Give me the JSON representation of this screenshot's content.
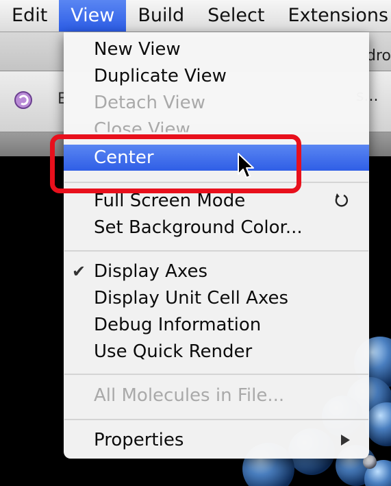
{
  "menubar": {
    "items": [
      "Edit",
      "View",
      "Build",
      "Select",
      "Extensions"
    ],
    "active": "View"
  },
  "background": {
    "tab_text": "dro",
    "toolbar_peek_letter": "E",
    "toolbar_dropdown_text": "s..."
  },
  "view_menu": {
    "items": [
      {
        "label": "New View",
        "enabled": true
      },
      {
        "label": "Duplicate View",
        "enabled": true
      },
      {
        "label": "Detach View",
        "enabled": false
      },
      {
        "label": "Close View",
        "enabled": false
      },
      {
        "label": "Center",
        "enabled": true,
        "highlighted": true
      },
      {
        "label": "Full Screen Mode",
        "enabled": true,
        "shortcut_icon": "rotate-refresh-icon"
      },
      {
        "label": "Set Background Color...",
        "enabled": true
      },
      {
        "label": "Display Axes",
        "enabled": true,
        "checked": true
      },
      {
        "label": "Display Unit Cell Axes",
        "enabled": true
      },
      {
        "label": "Debug Information",
        "enabled": true
      },
      {
        "label": "Use Quick Render",
        "enabled": true
      },
      {
        "label": "All Molecules in File...",
        "enabled": false
      },
      {
        "label": "Properties",
        "enabled": true,
        "submenu": true
      }
    ]
  },
  "annotation": {
    "target": "Center",
    "color": "#e8101c"
  },
  "colors": {
    "highlight": "#3b6cea",
    "disabled_text": "#a9a9a9",
    "molecule": "#4a7fc0"
  }
}
